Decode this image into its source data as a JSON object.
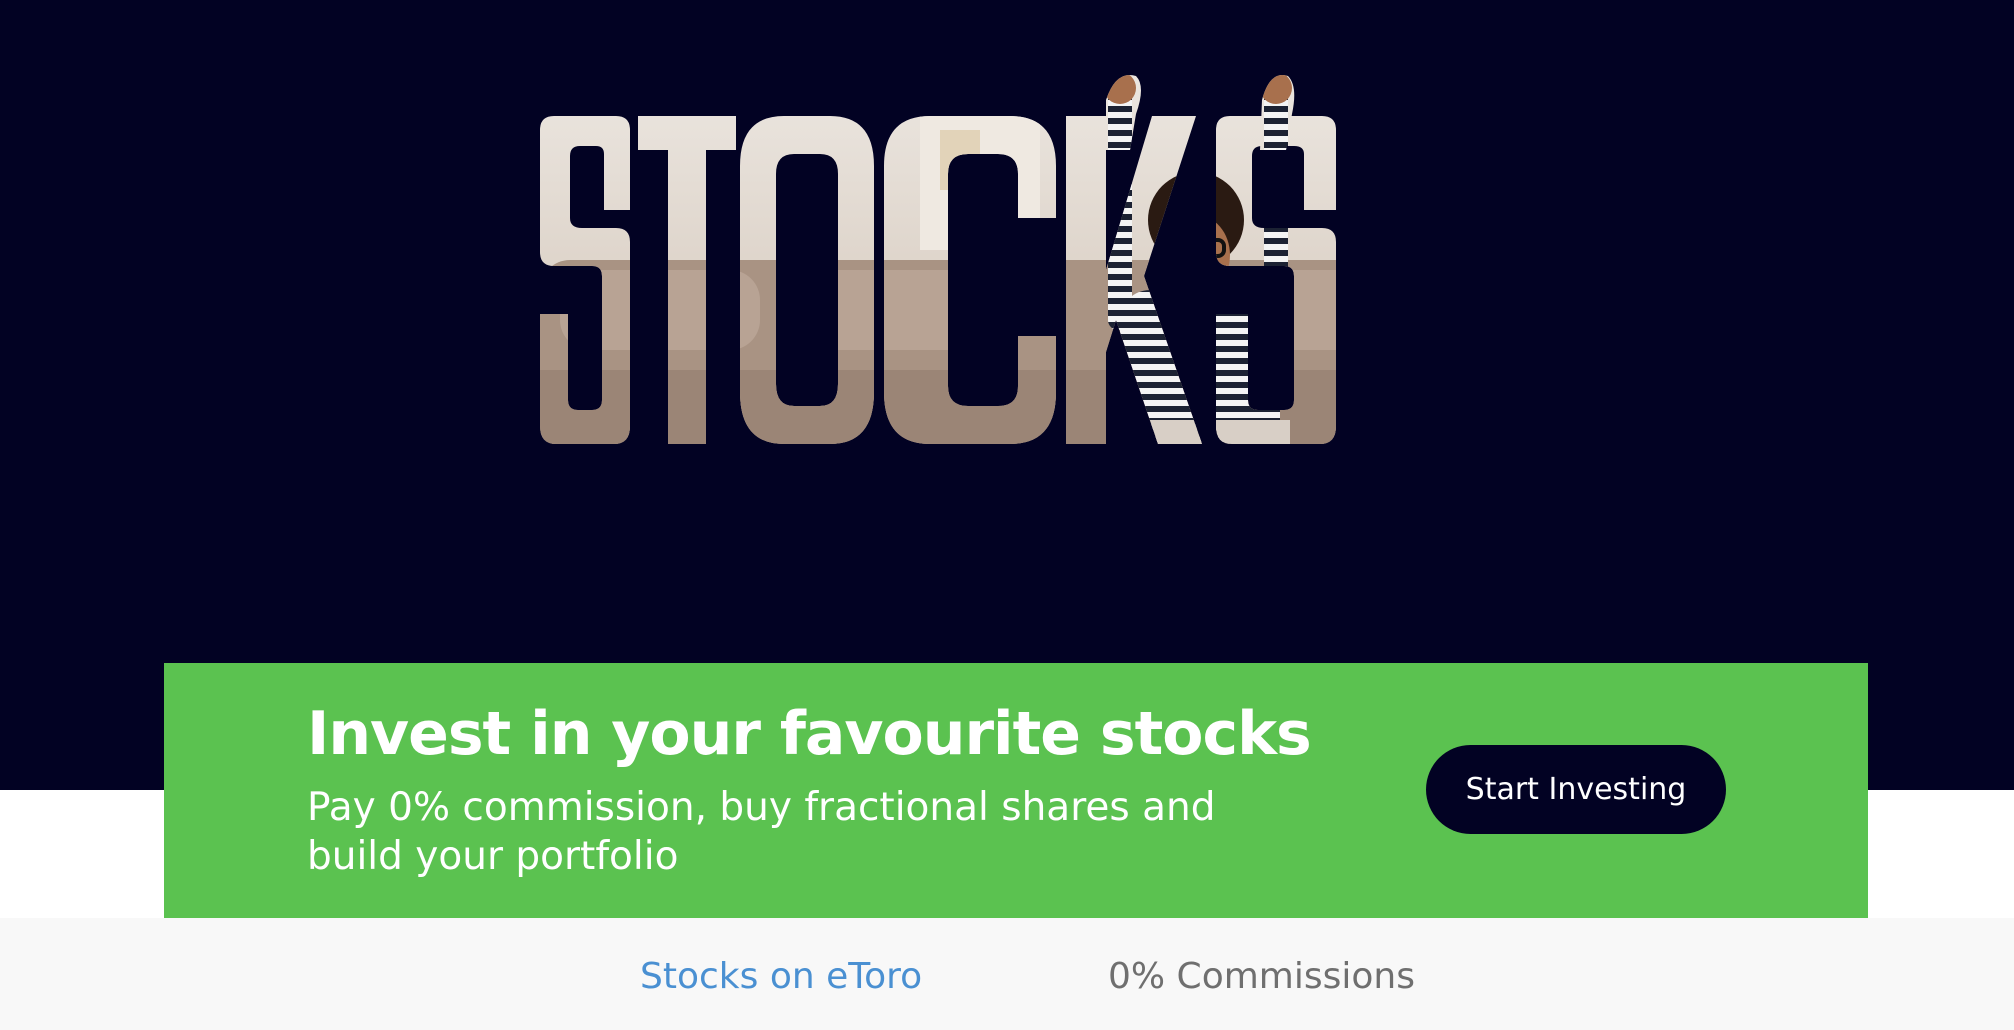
{
  "hero": {
    "word": "STOCKS",
    "image": "woman-celebrating-on-sofa",
    "colors": {
      "background": "#020223",
      "letter_fill": "#d4c8bc"
    }
  },
  "promo": {
    "title": "Invest in your favourite stocks",
    "subtitle": "Pay 0% commission, buy fractional shares and build your portfolio",
    "cta_label": "Start Investing",
    "colors": {
      "background": "#5bc250",
      "button": "#020223"
    }
  },
  "tabs": [
    {
      "label": "Stocks on eToro",
      "active": true
    },
    {
      "label": "0% Commissions",
      "active": false
    }
  ],
  "colors": {
    "tab_active": "#4a90d2",
    "tab_inactive": "#6f6f6f"
  }
}
